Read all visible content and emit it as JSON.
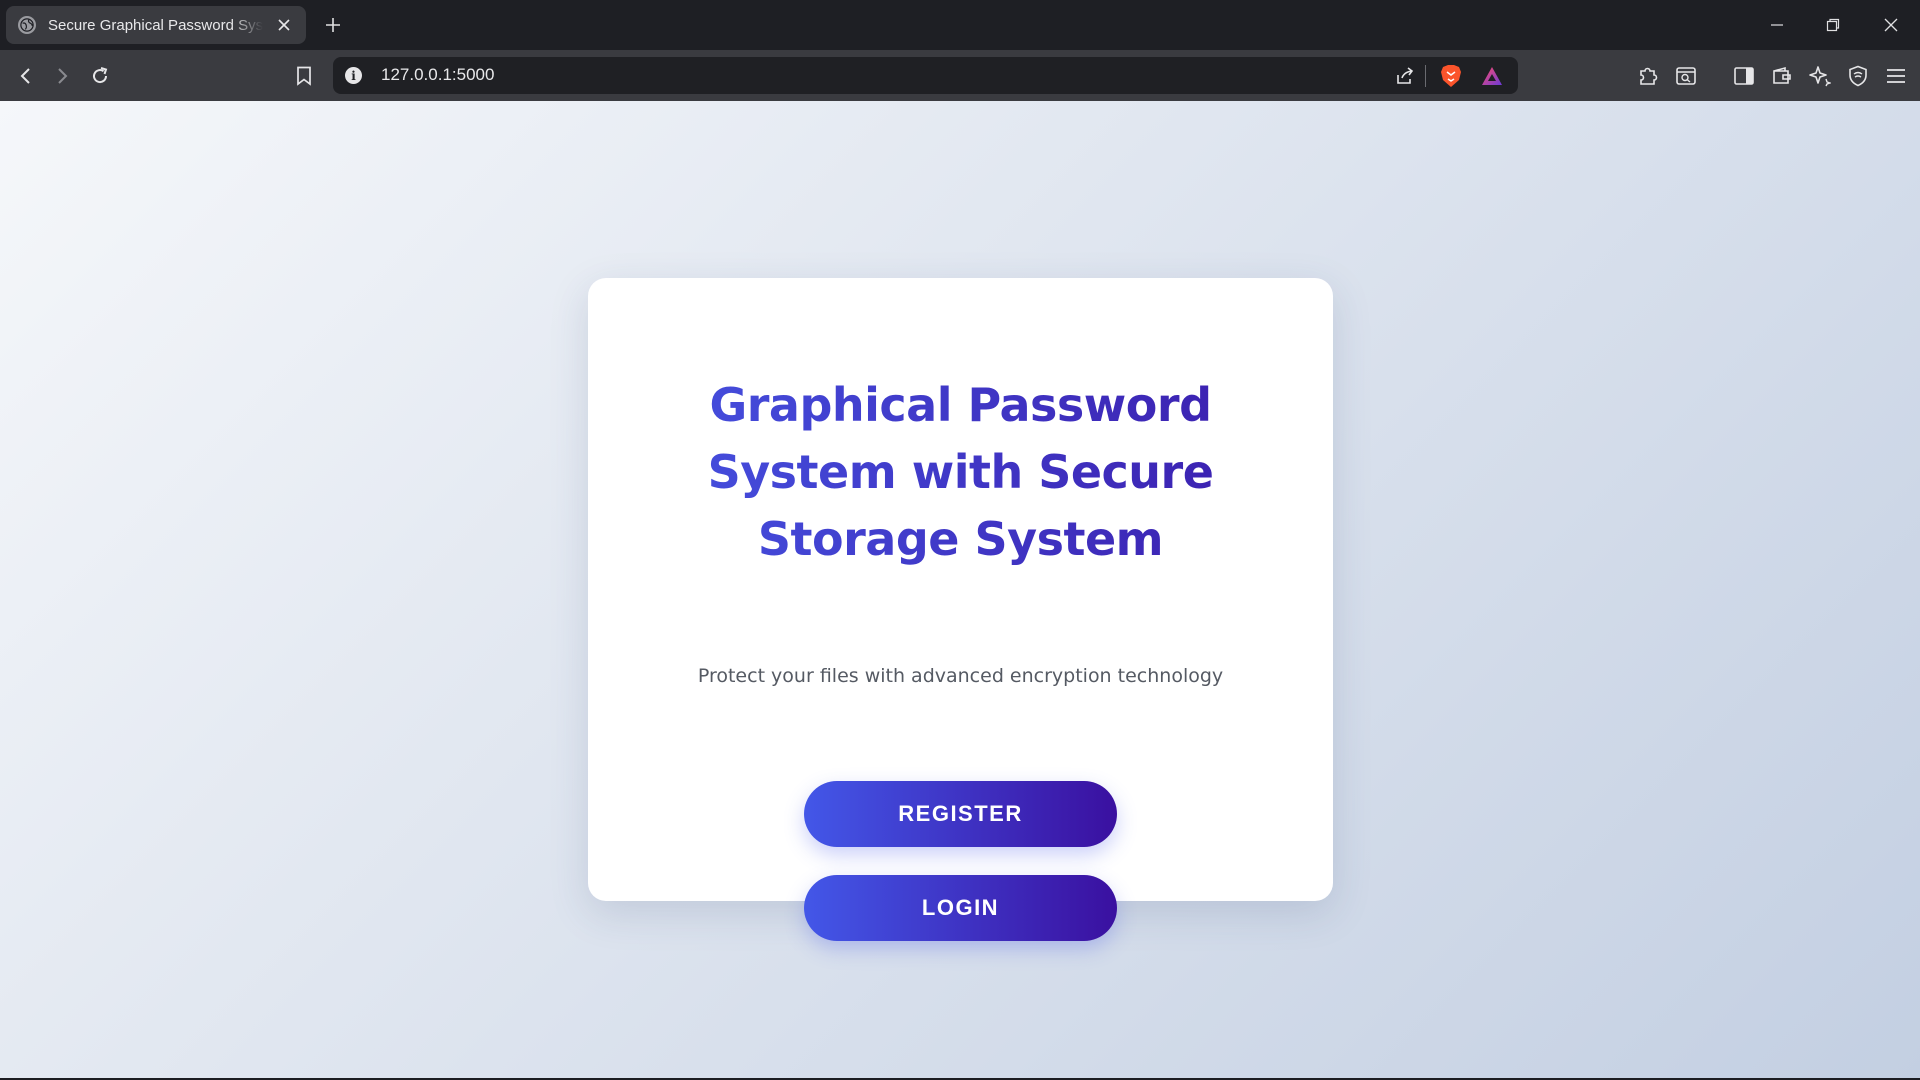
{
  "browser": {
    "tab_title": "Secure Graphical Password System",
    "url": "127.0.0.1:5000",
    "icons": {
      "favicon": "globe-icon",
      "tab_close": "close-icon",
      "new_tab": "plus-icon",
      "back": "back-arrow-icon",
      "forward": "forward-arrow-icon",
      "reload": "reload-icon",
      "bookmark": "bookmark-icon",
      "site_info": "info-icon",
      "share": "share-icon",
      "brave_shields": "brave-lion-icon",
      "brave_rewards": "triangle-rewards-icon",
      "extensions": "puzzle-icon",
      "reader": "reader-mode-icon",
      "sidebar": "sidebar-icon",
      "wallet": "wallet-icon",
      "leo": "sparkle-icon",
      "vpn": "shield-icon",
      "menu": "hamburger-menu-icon"
    }
  },
  "page": {
    "title_lines": [
      "Graphical Password",
      "System with Secure",
      "Storage System"
    ],
    "subtitle": "Protect your files with advanced encryption technology",
    "register_label": "REGISTER",
    "login_label": "LOGIN"
  },
  "colors": {
    "gradient_start": "#4357e8",
    "gradient_end": "#3a10a0",
    "background_start": "#f5f7fa",
    "background_end": "#c3cfe2"
  }
}
